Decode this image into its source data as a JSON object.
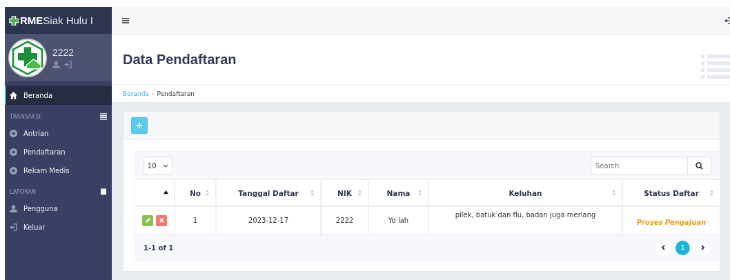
{
  "brand": {
    "bold": "RME",
    "rest": "Siak Hulu I"
  },
  "user": {
    "name": "2222"
  },
  "sidebar": {
    "items": [
      {
        "kind": "link",
        "label": "Beranda",
        "selected": true
      },
      {
        "kind": "header",
        "label": "TRANSAKSI"
      },
      {
        "kind": "link",
        "label": "Antrian",
        "selected": false
      },
      {
        "kind": "link",
        "label": "Pendaftaran",
        "selected": false
      },
      {
        "kind": "link",
        "label": "Rekam Medis",
        "selected": false
      },
      {
        "kind": "header",
        "label": "LAPORAN"
      },
      {
        "kind": "link",
        "label": "Pengguna",
        "selected": false
      },
      {
        "kind": "link",
        "label": "Keluar",
        "selected": false
      }
    ]
  },
  "page_title": "Data Pendaftaran",
  "breadcrumb": [
    "Beranda",
    "Pendaftaran"
  ],
  "breadcrumb_separator": "›",
  "table": {
    "page_size": "10",
    "search": {
      "placeholder": "Search"
    },
    "columns": [
      {
        "sorted": true
      },
      {
        "label": "No",
        "sorted": false
      },
      {
        "label": "Tanggal Daftar",
        "sorted": false
      },
      {
        "label": "NIK",
        "sorted": false
      },
      {
        "label": "Nama",
        "sorted": false
      },
      {
        "label": "Keluhan",
        "sorted": false
      },
      {
        "label": "Status Daftar",
        "sorted": false
      }
    ],
    "rows": [
      {
        "no": "1",
        "tanggal": "2023-12-17",
        "nik": "2222",
        "nama": "Yo lah",
        "keluhan": "pilek, batuk dan flu, badan juga meriang",
        "status": "Proses Pengajuan",
        "color": "#e8a317"
      }
    ],
    "summary": "1-1 of 1",
    "pages": [
      {
        "label": "1",
        "selected": true
      }
    ]
  }
}
